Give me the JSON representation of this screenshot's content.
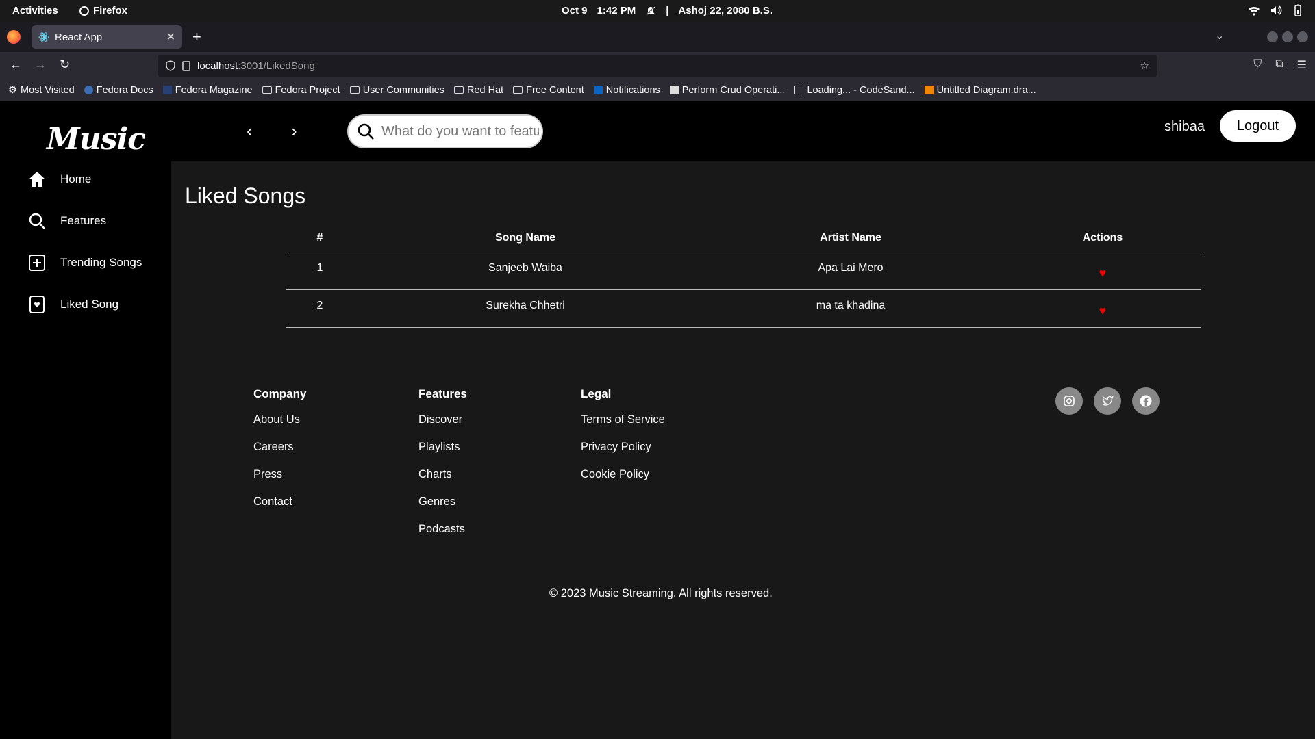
{
  "system_bar": {
    "activities": "Activities",
    "app_name": "Firefox",
    "date": "Oct 9",
    "time": "1:42 PM",
    "separator": "|",
    "nepali_date": "Ashoj 22, 2080 B.S."
  },
  "browser": {
    "tab_title": "React App",
    "url_host": "localhost",
    "url_path": ":3001/LikedSong",
    "bookmarks": [
      {
        "label": "Most Visited",
        "icon": "gear-icon"
      },
      {
        "label": "Fedora Docs",
        "icon": "fedora-icon"
      },
      {
        "label": "Fedora Magazine",
        "icon": "fedora-magazine-icon"
      },
      {
        "label": "Fedora Project",
        "icon": "folder-icon"
      },
      {
        "label": "User Communities",
        "icon": "folder-icon"
      },
      {
        "label": "Red Hat",
        "icon": "folder-icon"
      },
      {
        "label": "Free Content",
        "icon": "folder-icon"
      },
      {
        "label": "Notifications",
        "icon": "linkedin-icon"
      },
      {
        "label": "Perform Crud Operati...",
        "icon": "page-icon"
      },
      {
        "label": "Loading... - CodeSand...",
        "icon": "codesandbox-icon"
      },
      {
        "label": "Untitled Diagram.dra...",
        "icon": "drawio-icon"
      }
    ]
  },
  "app": {
    "logo": "Music",
    "sidebar": [
      {
        "label": "Home",
        "icon": "home-icon"
      },
      {
        "label": "Features",
        "icon": "search-icon"
      },
      {
        "label": "Trending Songs",
        "icon": "plus-square-icon"
      },
      {
        "label": "Liked Song",
        "icon": "heart-square-icon"
      }
    ],
    "search_placeholder": "What do you want to feature?",
    "username": "shibaa",
    "logout_label": "Logout",
    "page_title": "Liked Songs",
    "table": {
      "headers": [
        "#",
        "Song Name",
        "Artist Name",
        "Actions"
      ],
      "rows": [
        {
          "num": "1",
          "song": "Sanjeeb Waiba",
          "artist": "Apa Lai Mero"
        },
        {
          "num": "2",
          "song": "Surekha Chhetri",
          "artist": "ma ta khadina"
        }
      ]
    },
    "footer": {
      "company": {
        "title": "Company",
        "links": [
          "About Us",
          "Careers",
          "Press",
          "Contact"
        ]
      },
      "features": {
        "title": "Features",
        "links": [
          "Discover",
          "Playlists",
          "Charts",
          "Genres",
          "Podcasts"
        ]
      },
      "legal": {
        "title": "Legal",
        "links": [
          "Terms of Service",
          "Privacy Policy",
          "Cookie Policy"
        ]
      },
      "social": [
        "instagram-icon",
        "twitter-icon",
        "facebook-icon"
      ],
      "copyright": "© 2023 Music Streaming. All rights reserved."
    },
    "colors": {
      "heart": "#ee0000",
      "sidebar_bg": "#000000",
      "main_bg": "#181818"
    }
  }
}
